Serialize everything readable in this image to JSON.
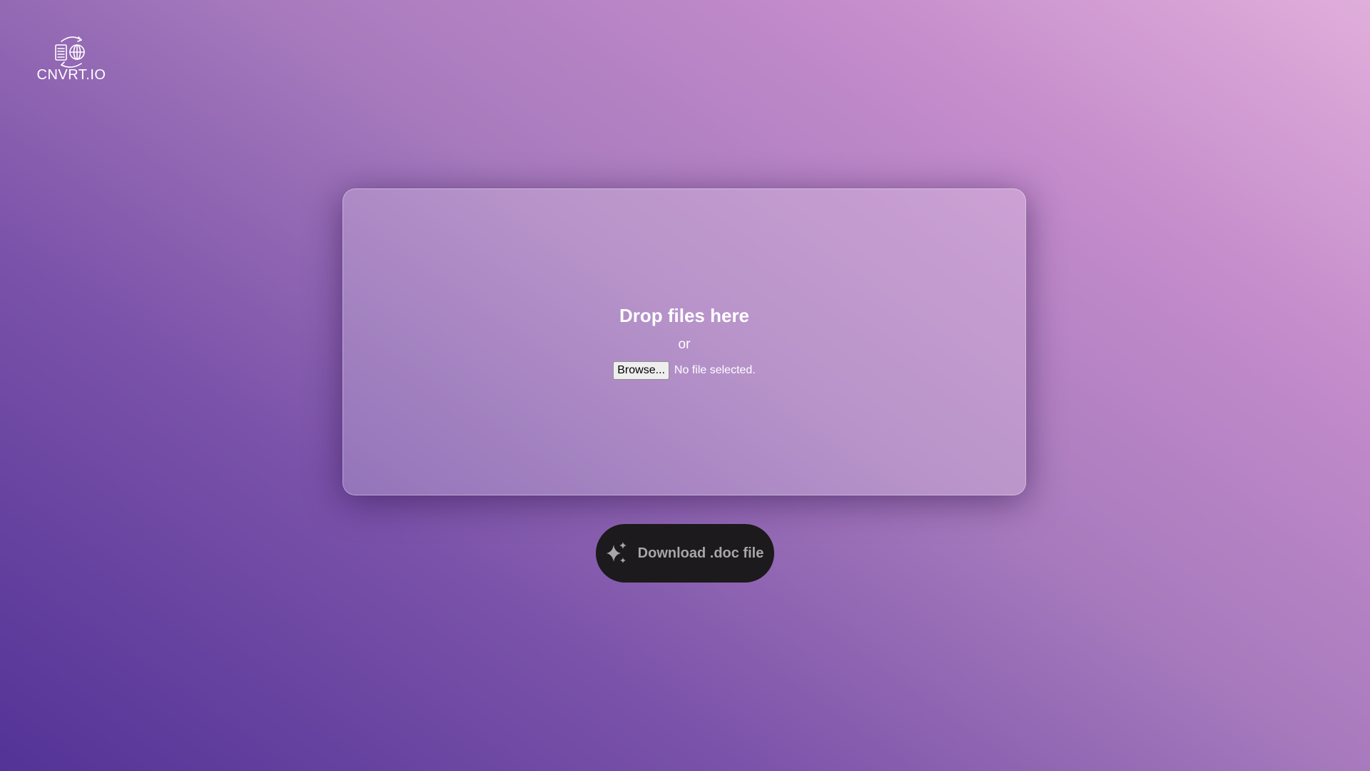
{
  "logo": {
    "text": "CNVRT.IO",
    "icon": "document-globe-convert-icon"
  },
  "dropzone": {
    "title": "Drop files here",
    "or_text": "or",
    "browse_label": "Browse...",
    "file_status": "No file selected."
  },
  "download": {
    "label": "Download .doc file",
    "icon": "sparkle-icon"
  },
  "colors": {
    "gradient_start": "#533397",
    "gradient_end": "#e0aedb",
    "button_bg": "#1c1a1d",
    "button_text": "#a8a5ab"
  }
}
